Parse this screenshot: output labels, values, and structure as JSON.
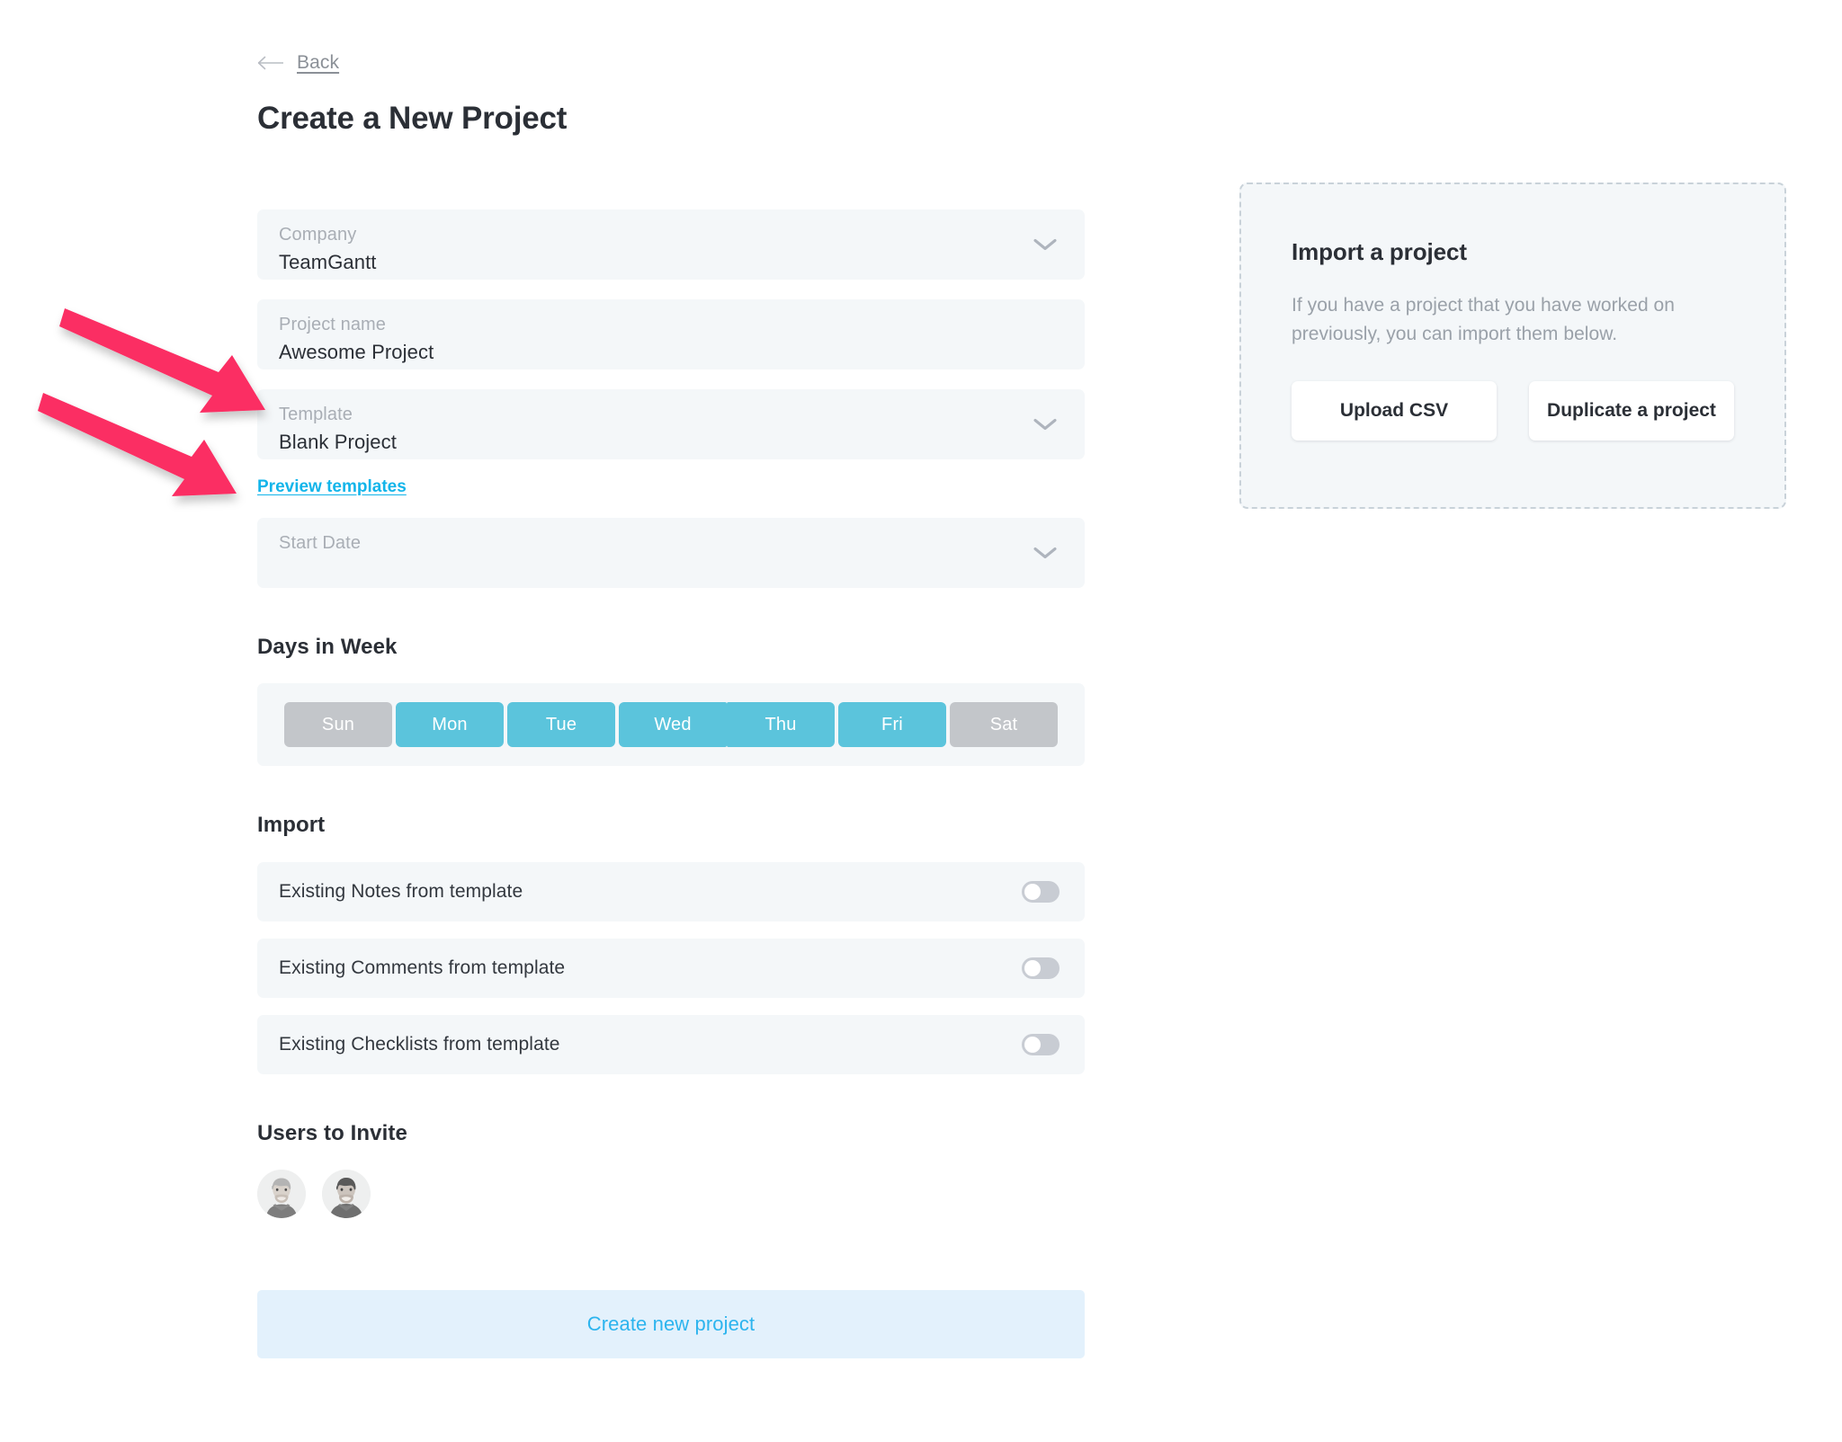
{
  "nav": {
    "back_label": "Back",
    "back_icon": "arrow-left-icon"
  },
  "header": {
    "title": "Create a New Project"
  },
  "form": {
    "fields": [
      {
        "label": "Company",
        "value": "TeamGantt",
        "icon": "chevron-down-icon",
        "type": "select"
      },
      {
        "label": "Project name",
        "value": "Awesome Project",
        "icon": "",
        "type": "text"
      },
      {
        "label": "Template",
        "value": "Blank Project",
        "icon": "chevron-down-icon",
        "type": "select"
      },
      {
        "label": "Start Date",
        "value": "",
        "icon": "chevron-down-icon",
        "type": "select"
      }
    ],
    "preview_link": "Preview templates"
  },
  "days": {
    "heading": "Days in Week",
    "items": [
      {
        "label": "Sun",
        "selected": false
      },
      {
        "label": "Mon",
        "selected": true
      },
      {
        "label": "Tue",
        "selected": true
      },
      {
        "label": "Wed",
        "selected": true
      },
      {
        "label": "Thu",
        "selected": true
      },
      {
        "label": "Fri",
        "selected": true
      },
      {
        "label": "Sat",
        "selected": false
      }
    ],
    "color_selected": "#5bc4dc",
    "color_unselected": "#c3c6ca"
  },
  "import_section": {
    "heading": "Import",
    "rows": [
      {
        "label": "Existing Notes from template",
        "on": false
      },
      {
        "label": "Existing Comments from template",
        "on": false
      },
      {
        "label": "Existing Checklists from template",
        "on": false
      }
    ]
  },
  "users": {
    "heading": "Users to Invite",
    "avatars": [
      {
        "name": "avatar-user-1"
      },
      {
        "name": "avatar-user-2"
      }
    ]
  },
  "submit": {
    "label": "Create new project",
    "text_color": "#2cb4ee",
    "background": "#e3f1fc"
  },
  "import_panel": {
    "title": "Import a project",
    "description": "If you have a project that you have worked on previously, you can import them below.",
    "buttons": [
      {
        "label": "Upload CSV"
      },
      {
        "label": "Duplicate a project"
      }
    ]
  },
  "annotations": {
    "arrow_color": "#fb2d63",
    "arrows": [
      {
        "name": "arrow-pointing-to-template-field",
        "target": "Template"
      },
      {
        "name": "arrow-pointing-to-preview-templates-link",
        "target": "Preview templates"
      }
    ]
  }
}
